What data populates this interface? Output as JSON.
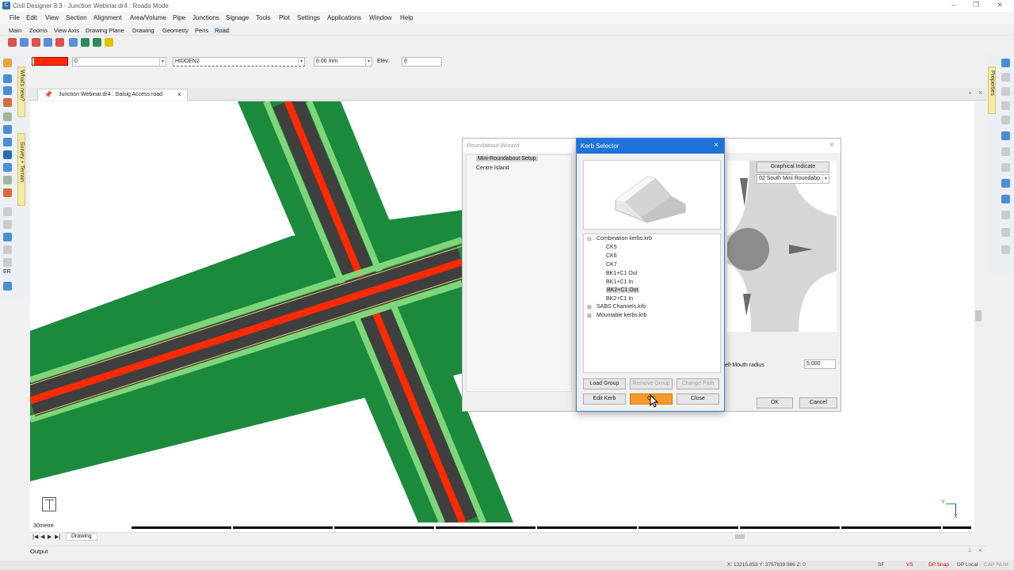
{
  "window": {
    "title": "Civil Designer 8.3 - Junction Webinar.dr4 : Roads Mode",
    "app_icon": "app-logo-icon"
  },
  "menu": [
    "File",
    "Edit",
    "View",
    "Section",
    "Alignment",
    "Area/Volume",
    "Pipe",
    "Junctions",
    "Signage",
    "Tools",
    "Plot",
    "Settings",
    "Applications",
    "Window",
    "Help"
  ],
  "ribbon_tabs": [
    "Main",
    "Zooms",
    "View Axis",
    "Drawing Plane",
    "Drawing",
    "Geometry",
    "Pens",
    "Road"
  ],
  "properties_bar": {
    "layer_value": "0",
    "linetype": "HIDDEN2",
    "width": "0.00 mm",
    "elev_label": "Elev.",
    "elev_value": "0",
    "pen_color": "#ff2a00"
  },
  "side_tabs": {
    "whats_new": "What's new?",
    "survey_terrain": "Survey + Terrain",
    "properties": "Properties"
  },
  "document_tab": {
    "title": "Junction Webinar.dr4 : Dalsig Access road",
    "close": "×"
  },
  "canvas": {
    "scale_label": "30metre",
    "drawing_tab": "Drawing",
    "axis_y": "Y",
    "axis_x": "X"
  },
  "output": {
    "label": "Output"
  },
  "status": {
    "coords": "X: 13215.853 Y: 3757839.986 Z: 0",
    "items": [
      "SF",
      "VS",
      "DP Snap",
      "DP Local",
      "CAP",
      "NUM"
    ]
  },
  "wizard": {
    "title": "Roundabout Wizard",
    "tree": [
      "Mini-Roundabout Setup",
      "Centre Island"
    ],
    "graphical_button": "Graphical Indicate",
    "type_select": "02 South Mini Roundabo",
    "bell_mouth_label": "ell-Mouth radius",
    "bell_mouth_value": "5.000",
    "ok": "OK",
    "cancel": "Cancel"
  },
  "kerb_selector": {
    "title": "Kerb Selector",
    "groups": [
      {
        "name": "Combination kerbs.krb",
        "expanded": true,
        "items": [
          "CK5",
          "CK6",
          "CK7",
          "BK1+C1 Out",
          "BK1+C1 In",
          "BK2+C1 Out",
          "BK2+C1 In"
        ]
      },
      {
        "name": "SABS Channels.krb",
        "expanded": false,
        "items": []
      },
      {
        "name": "Mountable kerbs.krb",
        "expanded": false,
        "items": []
      }
    ],
    "selected": "BK2+C1 Out",
    "buttons": {
      "load_group": "Load Group",
      "remove_group": "Remove Group",
      "change_path": "Change Path",
      "edit_kerb": "Edit Kerb",
      "ok": "OK",
      "close": "Close"
    }
  },
  "colors": {
    "verge_dark": "#1b8a3c",
    "verge_light": "#7fd67a",
    "road": "#3f3f3f",
    "median": "#ff2a00",
    "accent": "#1e73d8",
    "hover_button": "#f59a2a"
  }
}
